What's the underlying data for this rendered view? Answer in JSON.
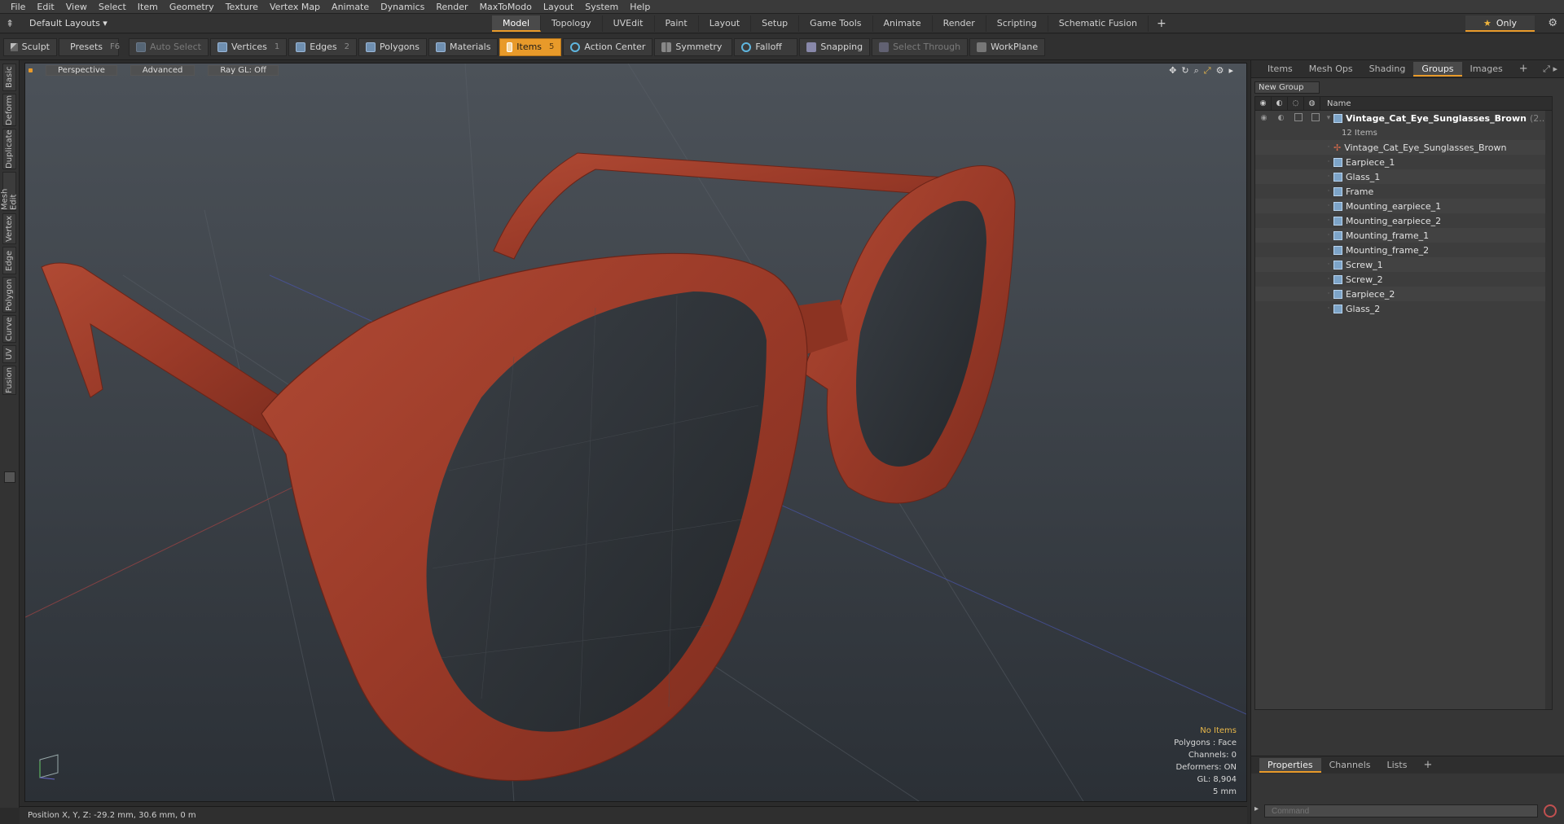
{
  "menu": [
    "File",
    "Edit",
    "View",
    "Select",
    "Item",
    "Geometry",
    "Texture",
    "Vertex Map",
    "Animate",
    "Dynamics",
    "Render",
    "MaxToModo",
    "Layout",
    "System",
    "Help"
  ],
  "layout": {
    "selector": "Default Layouts ▾",
    "tabs": [
      "Model",
      "Topology",
      "UVEdit",
      "Paint",
      "Layout",
      "Setup",
      "Game Tools",
      "Animate",
      "Render",
      "Scripting",
      "Schematic Fusion"
    ],
    "active_tab": "Model",
    "only_label": "Only"
  },
  "toolbar": {
    "sculpt": "Sculpt",
    "presets": "Presets",
    "presets_key": "F6",
    "auto_select": "Auto Select",
    "vertices": "Vertices",
    "vertices_key": "1",
    "edges": "Edges",
    "edges_key": "2",
    "polygons": "Polygons",
    "materials": "Materials",
    "items": "Items",
    "items_key": "5",
    "action_center": "Action Center",
    "symmetry": "Symmetry",
    "falloff": "Falloff",
    "snapping": "Snapping",
    "select_through": "Select Through",
    "workplane": "WorkPlane"
  },
  "left_tabs": [
    "Basic",
    "Deform",
    "Duplicate",
    "Mesh Edit",
    "Vertex",
    "Edge",
    "Polygon",
    "Curve",
    "UV",
    "Fusion"
  ],
  "viewport": {
    "view": "Perspective",
    "shading": "Advanced",
    "raygl": "Ray GL: Off",
    "stats": {
      "items": "No Items",
      "polygons": "Polygons : Face",
      "channels": "Channels: 0",
      "deformers": "Deformers: ON",
      "gl": "GL: 8,904",
      "grid": "5 mm"
    },
    "colors": {
      "frame": "#9a3a28",
      "bg_top": "#4a5058",
      "bg_bottom": "#2c3238"
    }
  },
  "status": "Position X, Y, Z:  -29.2 mm, 30.6 mm, 0 m",
  "right_panel": {
    "tabs": [
      "Items",
      "Mesh Ops",
      "Shading",
      "Groups",
      "Images"
    ],
    "active_tab": "Groups",
    "new_group": "New Group",
    "column_name": "Name",
    "group_name": "Vintage_Cat_Eye_Sunglasses_Brown",
    "group_suffix": "(2...",
    "group_count": "12 Items",
    "items": [
      {
        "name": "Vintage_Cat_Eye_Sunglasses_Brown",
        "kind": "locator"
      },
      {
        "name": "Earpiece_1",
        "kind": "mesh"
      },
      {
        "name": "Glass_1",
        "kind": "mesh"
      },
      {
        "name": "Frame",
        "kind": "mesh"
      },
      {
        "name": "Mounting_earpiece_1",
        "kind": "mesh"
      },
      {
        "name": "Mounting_earpiece_2",
        "kind": "mesh"
      },
      {
        "name": "Mounting_frame_1",
        "kind": "mesh"
      },
      {
        "name": "Mounting_frame_2",
        "kind": "mesh"
      },
      {
        "name": "Screw_1",
        "kind": "mesh"
      },
      {
        "name": "Screw_2",
        "kind": "mesh"
      },
      {
        "name": "Earpiece_2",
        "kind": "mesh"
      },
      {
        "name": "Glass_2",
        "kind": "mesh"
      }
    ],
    "bottom_tabs": [
      "Properties",
      "Channels",
      "Lists"
    ],
    "bottom_active": "Properties",
    "command_placeholder": "Command"
  }
}
